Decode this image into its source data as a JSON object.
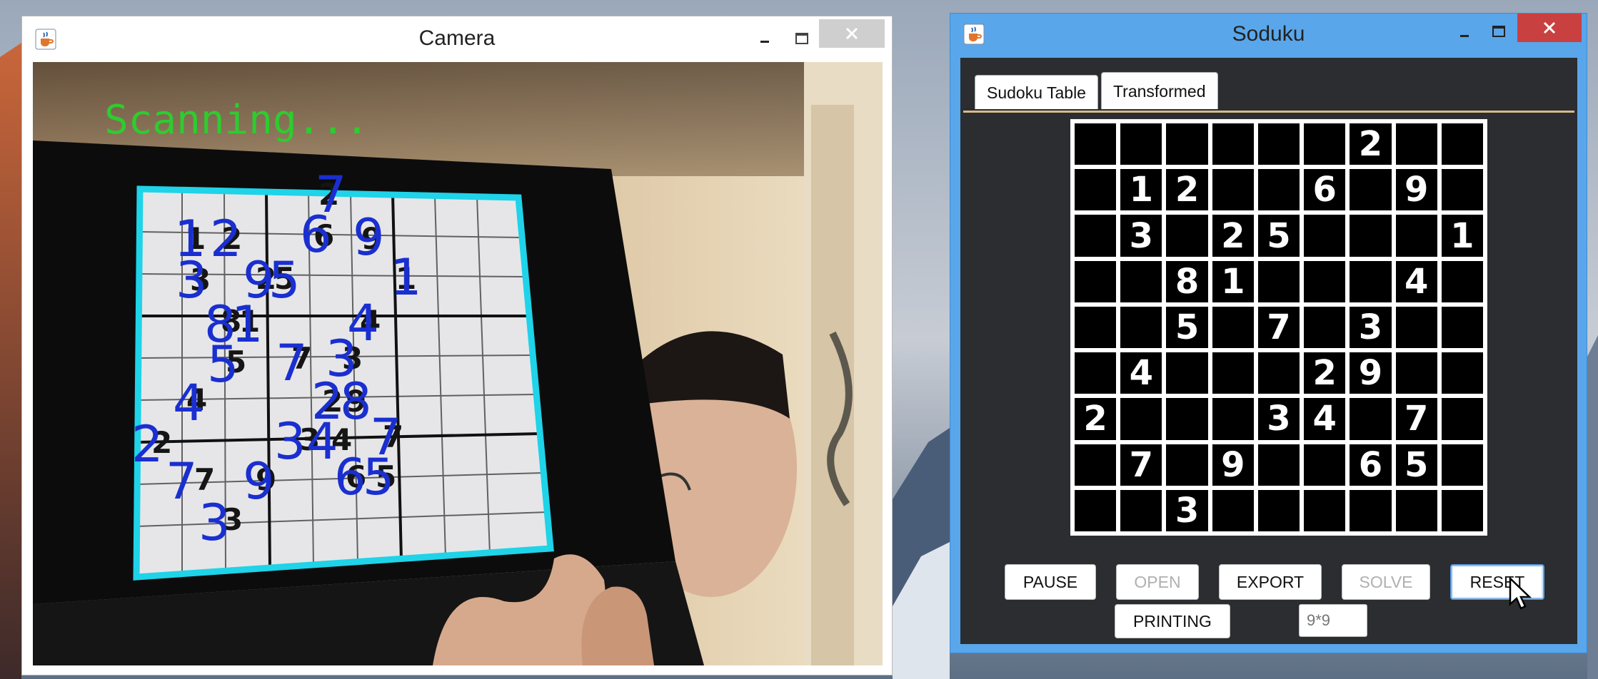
{
  "camera_window": {
    "title": "Camera",
    "icon": "java-cup-icon",
    "overlay_text": "Scanning...",
    "overlay_color": "#2ecc2e",
    "detected_grid_color": "#1fd3e8",
    "recognized_digit_color": "#1a2fd0",
    "paper_digits": [
      "2",
      "1",
      "2",
      "6",
      "9",
      "3",
      "2",
      "5",
      "1",
      "8",
      "1",
      "4",
      "5",
      "7",
      "3",
      "4",
      "2",
      "9",
      "2",
      "3",
      "4",
      "7",
      "7",
      "9",
      "6",
      "5",
      "3"
    ],
    "overlay_digits": [
      "7",
      "1",
      "2",
      "6",
      "9",
      "3",
      "9",
      "5",
      "1",
      "8",
      "1",
      "4",
      "5",
      "7",
      "3",
      "4",
      "2",
      "8",
      "2",
      "3",
      "4",
      "7",
      "7",
      "9",
      "6",
      "5",
      "3"
    ],
    "controls": [
      "minimize-icon",
      "maximize-icon",
      "close-icon"
    ]
  },
  "soduku_window": {
    "title": "Soduku",
    "icon": "java-cup-icon",
    "accent_color": "#5aa6ea",
    "close_color": "#c94040",
    "tabs": [
      {
        "label": "Sudoku Table",
        "active": false
      },
      {
        "label": "Transformed",
        "active": true
      }
    ],
    "grid": [
      [
        "",
        "",
        "",
        "",
        "",
        "",
        "2",
        "",
        ""
      ],
      [
        "",
        "1",
        "2",
        "",
        "",
        "6",
        "",
        "9",
        ""
      ],
      [
        "",
        "3",
        "",
        "2",
        "5",
        "",
        "",
        "",
        "1"
      ],
      [
        "",
        "",
        "8",
        "1",
        "",
        "",
        "",
        "4",
        ""
      ],
      [
        "",
        "",
        "5",
        "",
        "7",
        "",
        "3",
        "",
        ""
      ],
      [
        "",
        "4",
        "",
        "",
        "",
        "2",
        "9",
        "",
        ""
      ],
      [
        "2",
        "",
        "",
        "",
        "3",
        "4",
        "",
        "7",
        ""
      ],
      [
        "",
        "7",
        "",
        "9",
        "",
        "",
        "6",
        "5",
        ""
      ],
      [
        "",
        "",
        "3",
        "",
        "",
        "",
        "",
        "",
        ""
      ]
    ],
    "buttons": {
      "pause": {
        "label": "PAUSE",
        "enabled": true
      },
      "open": {
        "label": "OPEN",
        "enabled": false
      },
      "export": {
        "label": "EXPORT",
        "enabled": true
      },
      "solve": {
        "label": "SOLVE",
        "enabled": false
      },
      "reset": {
        "label": "RESET",
        "enabled": true
      },
      "printing": {
        "label": "PRINTING",
        "enabled": true
      }
    },
    "size_input": {
      "placeholder": "9*9"
    }
  }
}
